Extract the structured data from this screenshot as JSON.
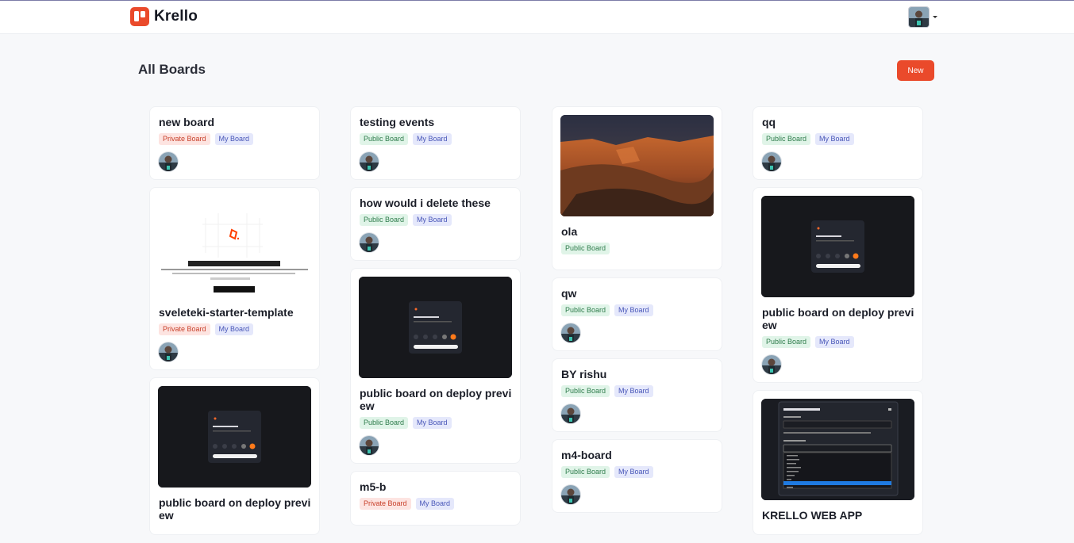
{
  "app": {
    "name": "Krello"
  },
  "page": {
    "title": "All Boards",
    "new_label": "New"
  },
  "colors": {
    "accent": "#ea4a2b"
  },
  "columns": [
    [
      {
        "title": "new board",
        "tags": [
          "Private Board",
          "My Board"
        ],
        "thumb": ""
      },
      {
        "title": "sveleteki-starter-template",
        "tags": [
          "Private Board",
          "My Board"
        ],
        "thumb": "svelte-starter"
      },
      {
        "title": "public board on deploy previ\new",
        "tags": [],
        "thumb": "dark-preview"
      }
    ],
    [
      {
        "title": "testing events",
        "tags": [
          "Public Board",
          "My Board"
        ],
        "thumb": ""
      },
      {
        "title": "how would i delete these",
        "tags": [
          "Public Board",
          "My Board"
        ],
        "thumb": ""
      },
      {
        "title": "public board on deploy previ\new",
        "tags": [
          "Public Board",
          "My Board"
        ],
        "thumb": "dark-preview"
      },
      {
        "title": "m5-b",
        "tags": [
          "Private Board",
          "My Board"
        ],
        "thumb": ""
      }
    ],
    [
      {
        "title": "ola",
        "tags": [
          "Public Board"
        ],
        "thumb": "canyon"
      },
      {
        "title": "qw",
        "tags": [
          "Public Board",
          "My Board"
        ],
        "thumb": ""
      },
      {
        "title": "BY rishu",
        "tags": [
          "Public Board",
          "My Board"
        ],
        "thumb": ""
      },
      {
        "title": "m4-board",
        "tags": [
          "Public Board",
          "My Board"
        ],
        "thumb": ""
      }
    ],
    [
      {
        "title": "qq",
        "tags": [
          "Public Board",
          "My Board"
        ],
        "thumb": ""
      },
      {
        "title": "public board on deploy previ\new",
        "tags": [
          "Public Board",
          "My Board"
        ],
        "thumb": "dark-preview"
      },
      {
        "title": "KRELLO WEB APP",
        "tags": [],
        "thumb": "create-attribute-form"
      }
    ]
  ],
  "icons": {
    "logo": "krello-logo-icon",
    "user": "user-avatar-icon",
    "caret": "chevron-down-icon"
  }
}
